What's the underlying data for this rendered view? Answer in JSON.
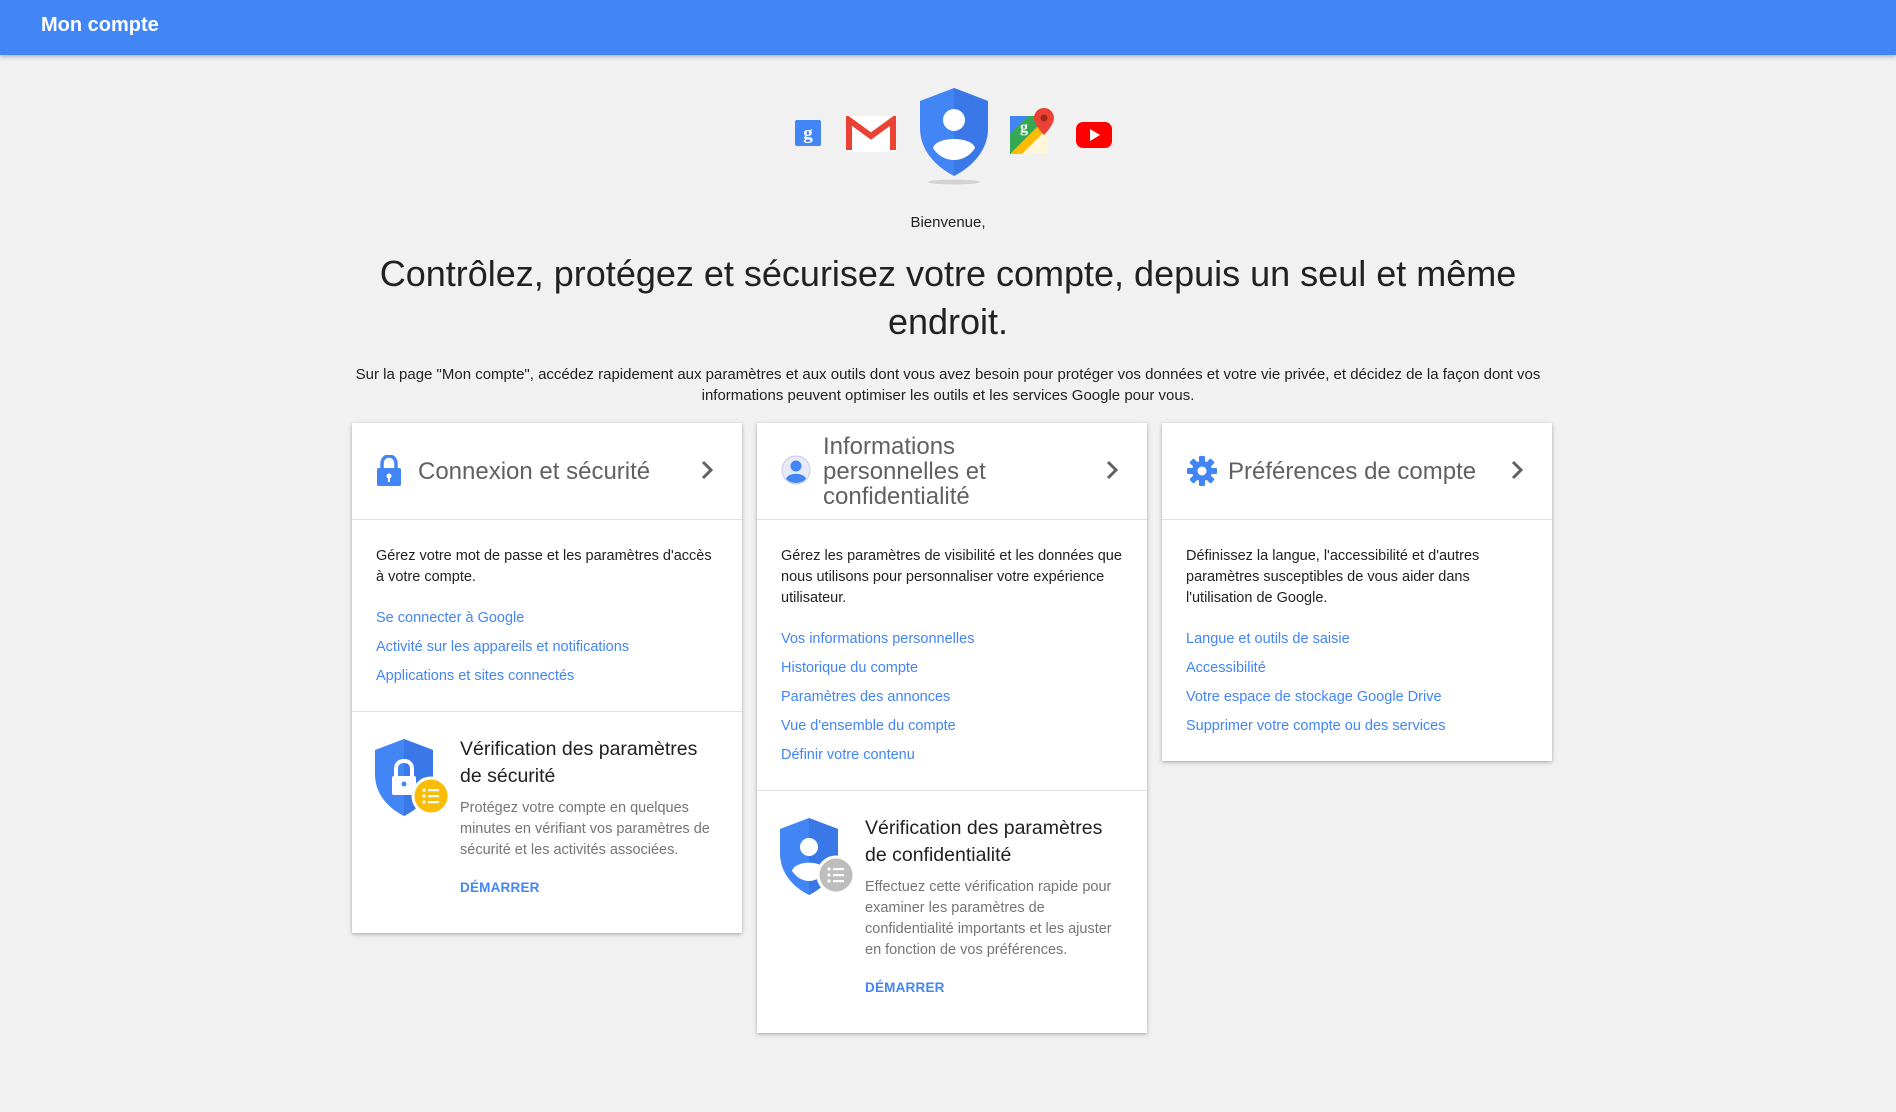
{
  "topbar": {
    "title": "Mon compte"
  },
  "hero": {
    "icons": [
      "google-plus-icon",
      "gmail-icon",
      "account-shield-icon",
      "maps-icon",
      "youtube-icon"
    ],
    "welcome": "Bienvenue,",
    "headline": "Contrôlez, protégez et sécurisez votre compte, depuis un seul et même endroit.",
    "intro": "Sur la page \"Mon compte\", accédez rapidement aux paramètres et aux outils dont vous avez besoin pour protéger vos données et votre vie privée, et décidez de la façon dont vos informations peuvent optimiser les outils et les services Google pour vous."
  },
  "cards": [
    {
      "title": "Connexion et sécurité",
      "icon": "lock-icon",
      "description": "Gérez votre mot de passe et les paramètres d'accès à votre compte.",
      "links": [
        "Se connecter à Google",
        "Activité sur les appareils et notifications",
        "Applications et sites connectés"
      ],
      "checkup": {
        "title": "Vérification des paramètres de sécurité",
        "description": "Protégez votre compte en quelques minutes en vérifiant vos paramètres de sécurité et les activités associées.",
        "action": "DÉMARRER"
      }
    },
    {
      "title": "Informations personnelles et confidentialité",
      "icon": "person-icon",
      "description": "Gérez les paramètres de visibilité et les données que nous utilisons pour personnaliser votre expérience utilisateur.",
      "links": [
        "Vos informations personnelles",
        "Historique du compte",
        "Paramètres des annonces",
        "Vue d'ensemble du compte",
        "Définir votre contenu"
      ],
      "checkup": {
        "title": "Vérification des paramètres de confidentialité",
        "description": "Effectuez cette vérification rapide pour examiner les paramètres de confidentialité importants et les ajuster en fonction de vos préférences.",
        "action": "DÉMARRER"
      }
    },
    {
      "title": "Préférences de compte",
      "icon": "gear-icon",
      "description": "Définissez la langue, l'accessibilité et d'autres paramètres susceptibles de vous aider dans l'utilisation de Google.",
      "links": [
        "Langue et outils de saisie",
        "Accessibilité",
        "Votre espace de stockage Google Drive",
        "Supprimer votre compte ou des services"
      ]
    }
  ],
  "colors": {
    "brand": "#4285f4",
    "link": "#4285f4",
    "background": "#f1f1f1",
    "card": "#ffffff",
    "security_badge": "#fbbc05",
    "privacy_badge": "#bdbdbd"
  }
}
